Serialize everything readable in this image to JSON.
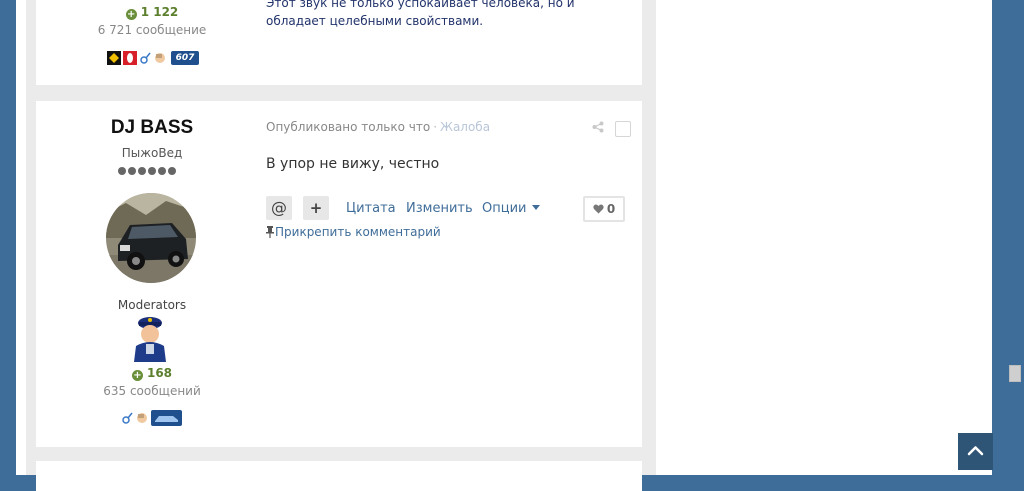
{
  "prev_post": {
    "reputation": "1 122",
    "post_count": "6 721 сообщение",
    "text_line1": "Этот звук не только успокаивает человека, но и",
    "text_line2": "обладает целебными свойствами.",
    "badge_label": "607"
  },
  "post": {
    "author": "DJ BASS",
    "rank": "ПыжоВед",
    "group": "Moderators",
    "reputation": "168",
    "post_count": "635 сообщений",
    "published": "Опубликовано только что",
    "separator": "·",
    "report": "Жалоба",
    "content": "В упор не вижу, честно",
    "actions": {
      "mention": "@",
      "add": "+",
      "quote": "Цитата",
      "edit": "Изменить",
      "options": "Опции"
    },
    "likes": "0",
    "pin": "Прикрепить комментарий"
  },
  "colors": {
    "accent": "#3f6d99",
    "reputation": "#5b7f2c",
    "background": "#ebebeb"
  }
}
